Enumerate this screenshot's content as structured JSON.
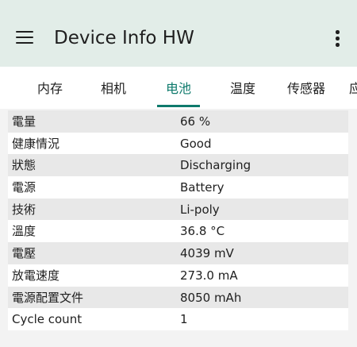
{
  "app": {
    "title": "Device Info HW"
  },
  "icons": {
    "menu": "hamburger-menu-icon",
    "more": "more-vertical-icon"
  },
  "colors": {
    "appbar_bg": "#e2ede8",
    "accent": "#0e7a6c",
    "row_alt": "#e8e8e8"
  },
  "tabs": [
    {
      "label": "内存",
      "active": false
    },
    {
      "label": "相机",
      "active": false
    },
    {
      "label": "电池",
      "active": true
    },
    {
      "label": "温度",
      "active": false
    },
    {
      "label": "传感器",
      "active": false
    },
    {
      "label": "应",
      "active": false
    }
  ],
  "battery": {
    "rows": [
      {
        "key": "電量",
        "value": "66 %"
      },
      {
        "key": "健康情況",
        "value": "Good"
      },
      {
        "key": "狀態",
        "value": "Discharging"
      },
      {
        "key": "電源",
        "value": "Battery"
      },
      {
        "key": "技術",
        "value": "Li-poly"
      },
      {
        "key": "溫度",
        "value": "36.8 °C"
      },
      {
        "key": "電壓",
        "value": "4039 mV"
      },
      {
        "key": "放電速度",
        "value": "273.0 mA"
      },
      {
        "key": "電源配置文件",
        "value": "8050 mAh"
      },
      {
        "key": "Cycle count",
        "value": "1"
      }
    ]
  }
}
